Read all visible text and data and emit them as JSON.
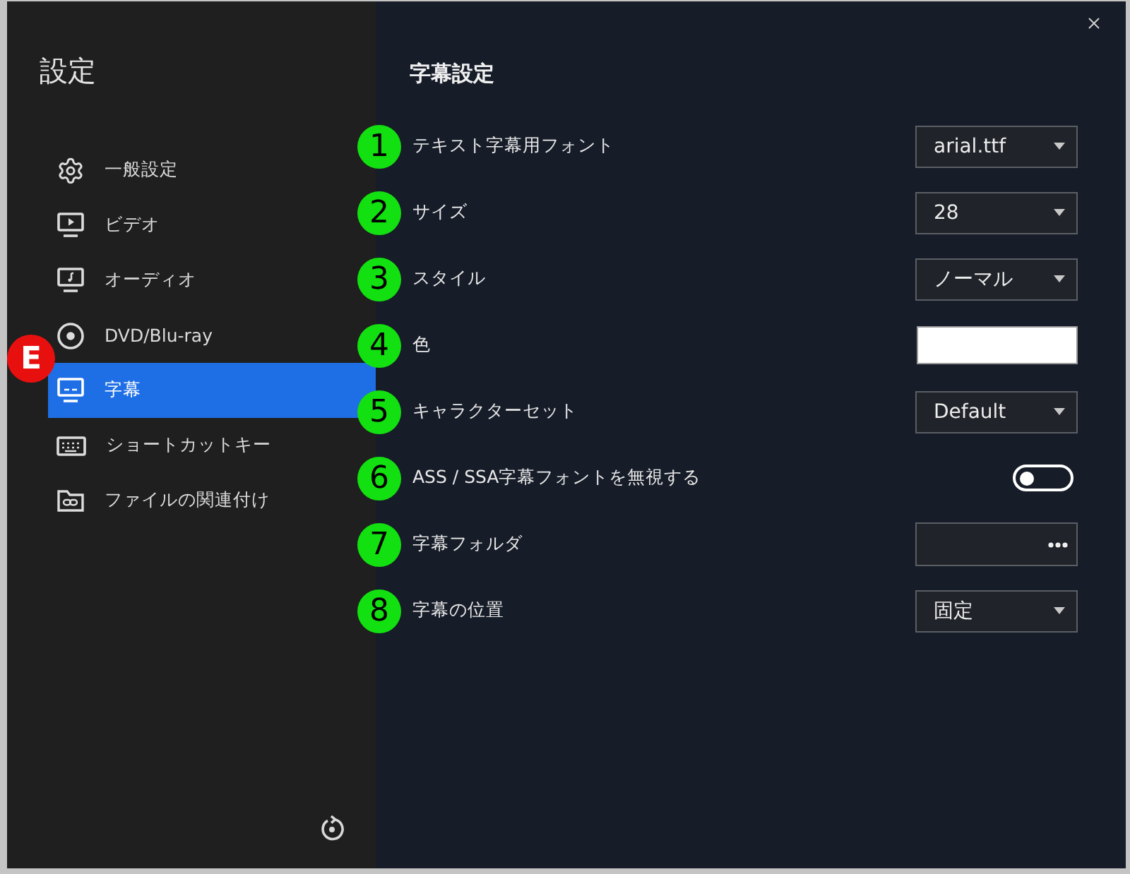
{
  "sidebar": {
    "title": "設定",
    "items": [
      {
        "kind": "general",
        "label": "一般設定",
        "selected": false
      },
      {
        "kind": "video",
        "label": "ビデオ",
        "selected": false
      },
      {
        "kind": "audio",
        "label": "オーディオ",
        "selected": false
      },
      {
        "kind": "disc",
        "label": "DVD/Blu-ray",
        "selected": false
      },
      {
        "kind": "subtitle",
        "label": "字幕",
        "selected": true,
        "marker": "E"
      },
      {
        "kind": "keyboard",
        "label": "ショートカットキー",
        "selected": false
      },
      {
        "kind": "association",
        "label": "ファイルの関連付け",
        "selected": false
      }
    ]
  },
  "panel": {
    "title": "字幕設定",
    "settings": [
      {
        "marker": "1",
        "label": "テキスト字幕用フォント",
        "kind": "dropdown",
        "value": "arial.ttf"
      },
      {
        "marker": "2",
        "label": "サイズ",
        "kind": "dropdown",
        "value": "28"
      },
      {
        "marker": "3",
        "label": "スタイル",
        "kind": "dropdown",
        "value": "ノーマル"
      },
      {
        "marker": "4",
        "label": "色",
        "kind": "color",
        "color": "#ffffff"
      },
      {
        "marker": "5",
        "label": "キャラクターセット",
        "kind": "dropdown",
        "value": "Default"
      },
      {
        "marker": "6",
        "label": "ASS / SSA字幕フォントを無視する",
        "kind": "toggle",
        "on": false
      },
      {
        "marker": "7",
        "label": "字幕フォルダ",
        "kind": "folder"
      },
      {
        "marker": "8",
        "label": "字幕の位置",
        "kind": "dropdown",
        "value": "固定"
      }
    ]
  }
}
